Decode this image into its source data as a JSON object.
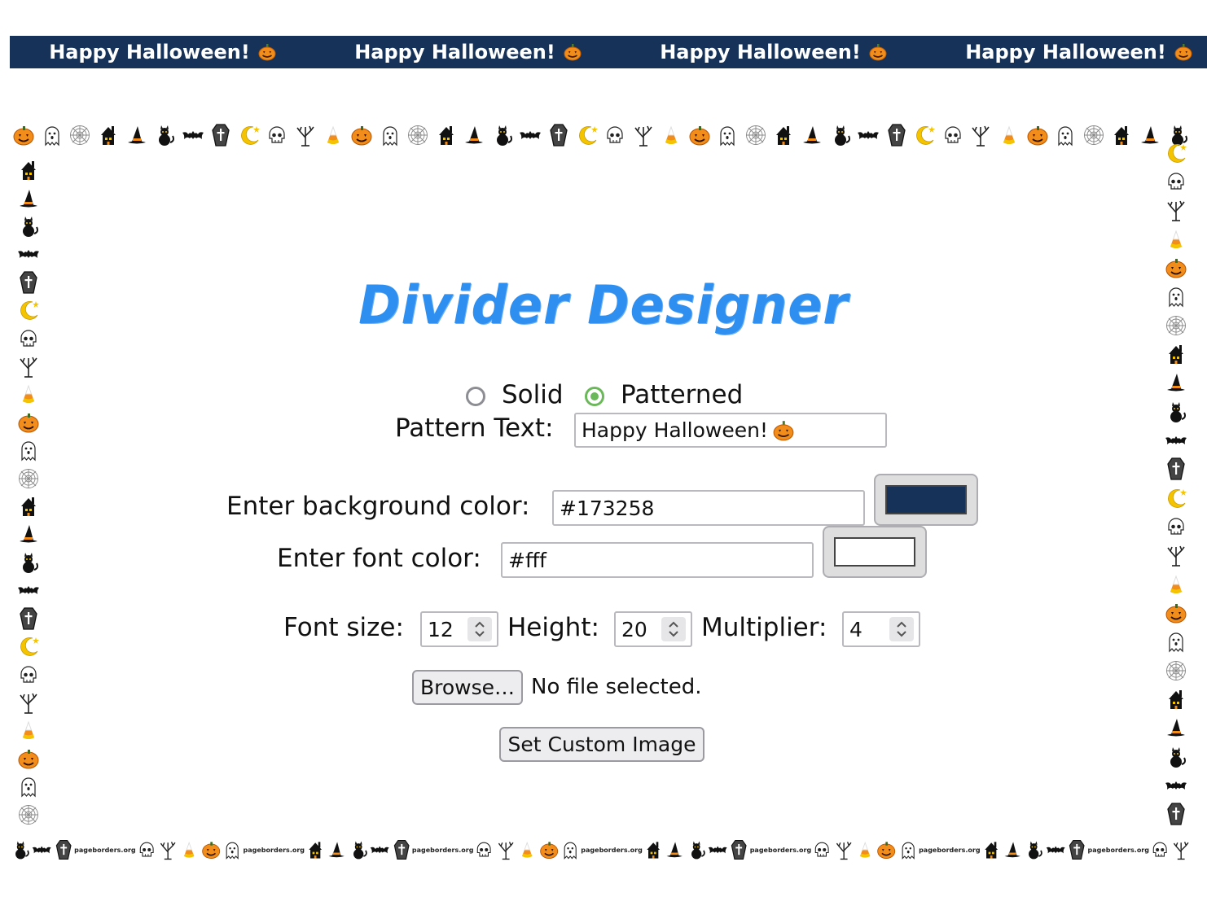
{
  "banner": {
    "items": [
      "Happy Halloween!",
      "Happy Halloween!",
      "Happy Halloween!",
      "Happy Halloween!"
    ],
    "background_color": "#173258",
    "font_color": "#ffffff",
    "icon": "jack-o-lantern-icon"
  },
  "border": {
    "theme": "halloween",
    "watermark": "pageborders.org",
    "icons": [
      "pumpkin-icon",
      "ghost-icon",
      "spider-web-icon",
      "haunted-house-icon",
      "witch-hat-icon",
      "black-cat-icon",
      "bat-icon",
      "coffin-icon",
      "moon-icon",
      "skull-icon",
      "bare-tree-icon",
      "candy-corn-icon"
    ]
  },
  "title": "Divider Designer",
  "title_color": "#2f8ff0",
  "style_options": {
    "solid_label": "Solid",
    "patterned_label": "Patterned",
    "selected": "Patterned"
  },
  "pattern_text": {
    "label": "Pattern Text:",
    "value": "Happy Halloween!"
  },
  "background_color": {
    "label": "Enter background color:",
    "value": "#173258"
  },
  "font_color": {
    "label": "Enter font color:",
    "value": "#fff"
  },
  "font_size": {
    "label": "Font size:",
    "value": "12"
  },
  "height": {
    "label": "Height:",
    "value": "20"
  },
  "multiplier": {
    "label": "Multiplier:",
    "value": "4"
  },
  "file": {
    "button_label": "Browse…",
    "status": "No file selected."
  },
  "set_custom_image_label": "Set Custom Image"
}
